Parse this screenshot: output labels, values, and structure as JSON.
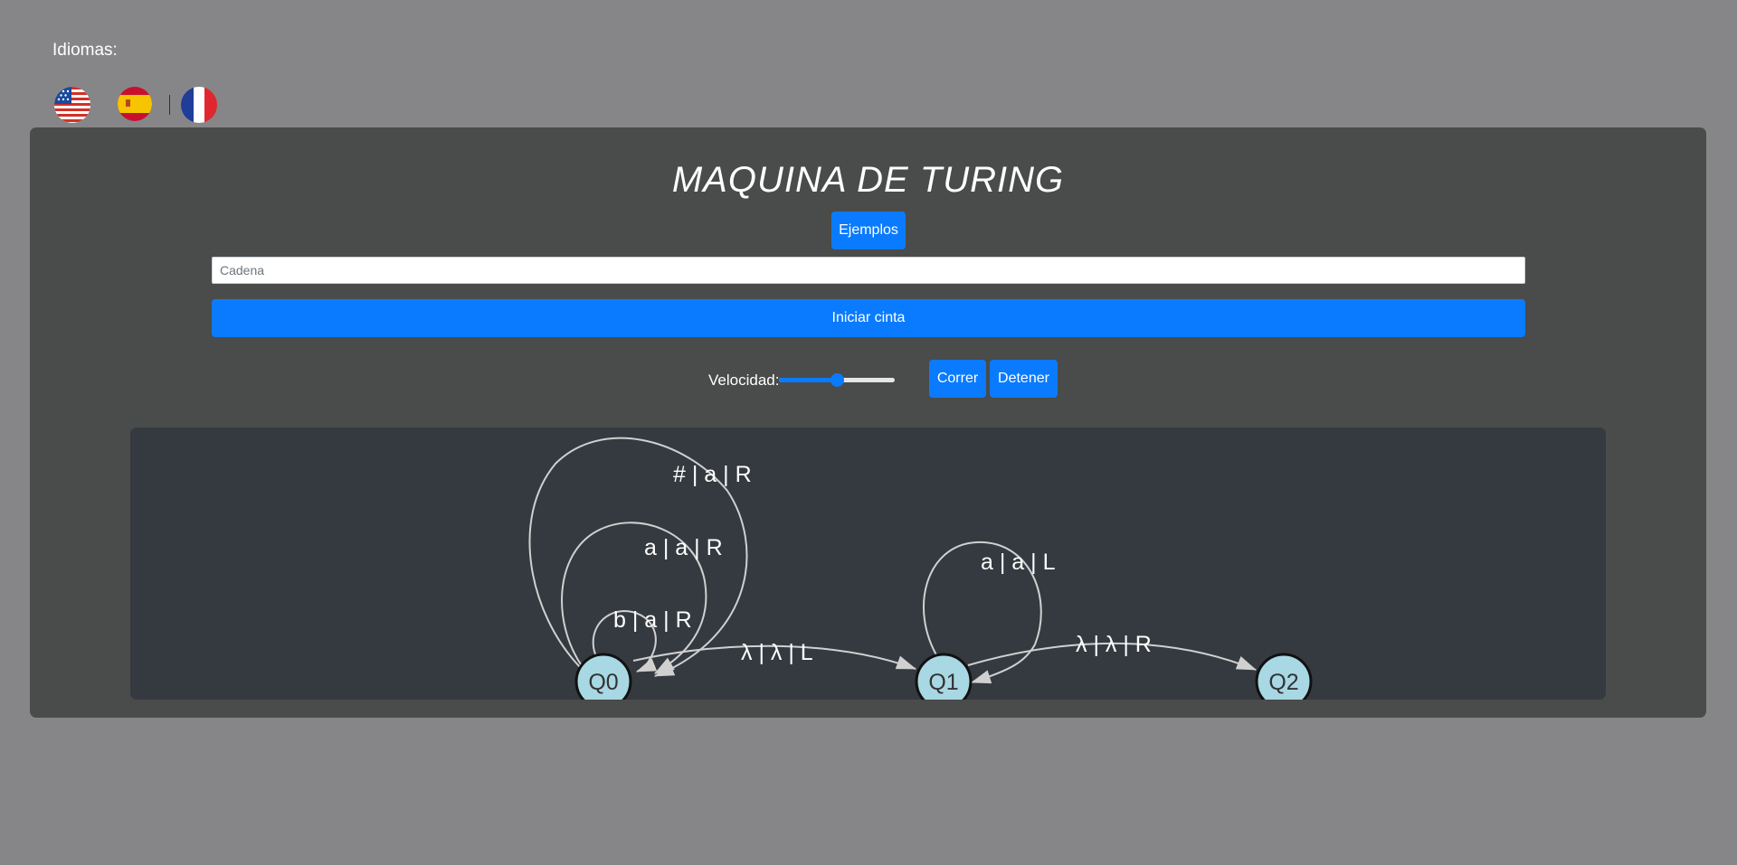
{
  "languages": {
    "label": "Idiomas:",
    "flags": [
      {
        "name": "english-flag-icon"
      },
      {
        "name": "spanish-flag-icon"
      },
      {
        "name": "french-flag-icon"
      }
    ]
  },
  "main": {
    "title": "MAQUINA DE TURING",
    "examples_button": "Ejemplos",
    "string_input": {
      "placeholder": "Cadena",
      "value": ""
    },
    "start_button": "Iniciar cinta",
    "speed": {
      "label": "Velocidad:",
      "value": 0.5
    },
    "run_button": "Correr",
    "stop_button": "Detener"
  },
  "graph": {
    "nodes": [
      {
        "id": "Q0",
        "label": "Q0"
      },
      {
        "id": "Q1",
        "label": "Q1"
      },
      {
        "id": "Q2",
        "label": "Q2"
      }
    ],
    "edges": [
      {
        "from": "Q0",
        "to": "Q0",
        "label": "# | a | R"
      },
      {
        "from": "Q0",
        "to": "Q0",
        "label": "a | a | R"
      },
      {
        "from": "Q0",
        "to": "Q0",
        "label": "b | a | R"
      },
      {
        "from": "Q0",
        "to": "Q1",
        "label": "λ | λ | L"
      },
      {
        "from": "Q1",
        "to": "Q1",
        "label": "a | a | L"
      },
      {
        "from": "Q1",
        "to": "Q2",
        "label": "λ | λ | R"
      }
    ],
    "colors": {
      "node_fill": "#a8d8e3",
      "node_stroke": "#111111",
      "edge": "#d0d0d0",
      "background": "#353a40"
    }
  }
}
